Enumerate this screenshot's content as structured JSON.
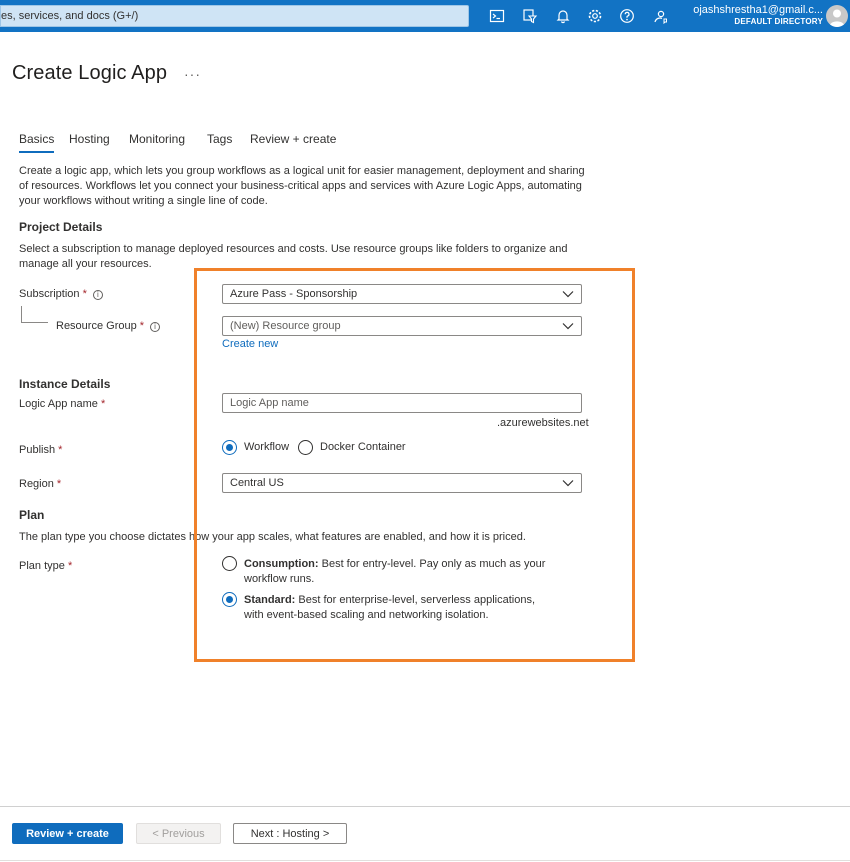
{
  "topbar": {
    "search_placeholder": "es, services, and docs (G+/)",
    "icons": [
      "cloud-shell-icon",
      "directory-filter-icon",
      "notifications-icon",
      "settings-icon",
      "help-icon",
      "feedback-icon"
    ],
    "account_email": "ojashshrestha1@gmail.c...",
    "account_directory": "DEFAULT DIRECTORY"
  },
  "page": {
    "title": "Create Logic App",
    "more": "···"
  },
  "tabs": [
    {
      "label": "Basics",
      "active": true
    },
    {
      "label": "Hosting",
      "active": false
    },
    {
      "label": "Monitoring",
      "active": false
    },
    {
      "label": "Tags",
      "active": false
    },
    {
      "label": "Review + create",
      "active": false
    }
  ],
  "intro": "Create a logic app, which lets you group workflows as a logical unit for easier management, deployment and sharing of resources. Workflows let you connect your business-critical apps and services with Azure Logic Apps, automating your workflows without writing a single line of code.",
  "project": {
    "heading": "Project Details",
    "description": "Select a subscription to manage deployed resources and costs. Use resource groups like folders to organize and manage all your resources.",
    "subscription_label": "Subscription",
    "subscription_value": "Azure Pass - Sponsorship",
    "resource_group_label": "Resource Group",
    "resource_group_value": "(New) Resource group",
    "create_new": "Create new"
  },
  "instance": {
    "heading": "Instance Details",
    "name_label": "Logic App name",
    "name_placeholder": "Logic App name",
    "name_suffix": ".azurewebsites.net",
    "publish_label": "Publish",
    "publish_options": [
      "Workflow",
      "Docker Container"
    ],
    "publish_selected": "Workflow",
    "region_label": "Region",
    "region_value": "Central US"
  },
  "plan": {
    "heading": "Plan",
    "description": "The plan type you choose dictates how your app scales, what features are enabled, and how it is priced.",
    "type_label": "Plan type",
    "options": [
      {
        "name": "Consumption:",
        "desc": "Best for entry-level. Pay only as much as your workflow runs.",
        "selected": false
      },
      {
        "name": "Standard:",
        "desc": "Best for enterprise-level, serverless applications, with event-based scaling and networking isolation.",
        "selected": true
      }
    ]
  },
  "required_marker": "*",
  "info_glyph": "i",
  "highlight_color": "#f0812a",
  "accent_color": "#0f6cbd",
  "footer": {
    "review_create": "Review + create",
    "previous": "< Previous",
    "next": "Next : Hosting >"
  }
}
